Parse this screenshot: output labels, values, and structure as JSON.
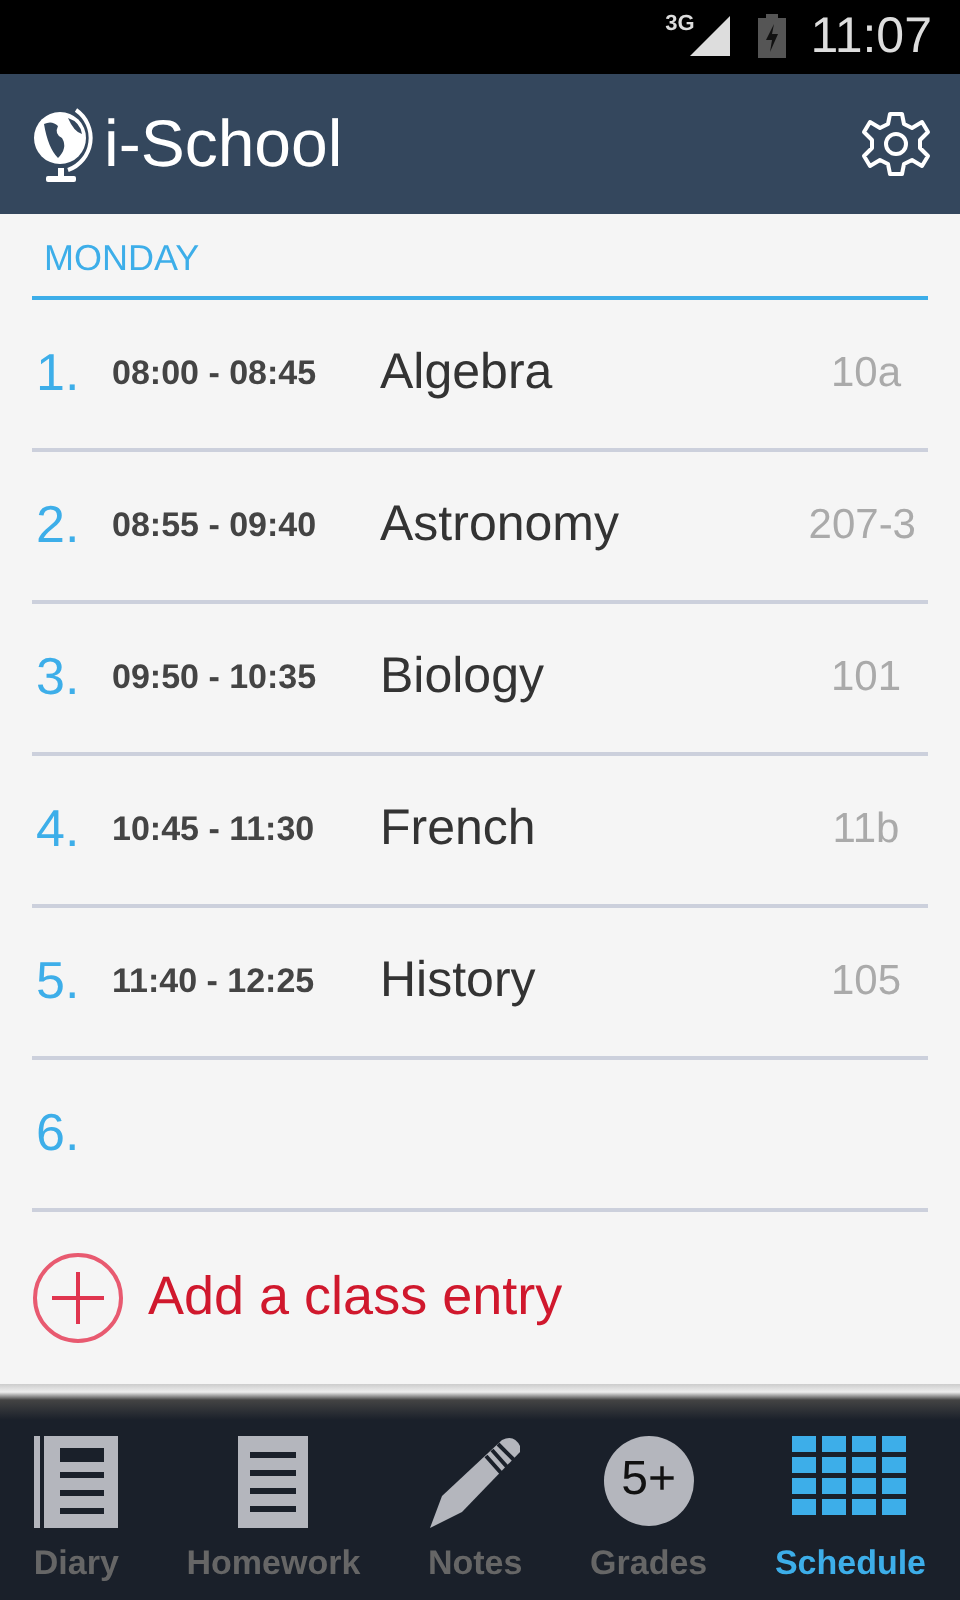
{
  "status_bar": {
    "network": "3G",
    "time": "11:07"
  },
  "app_bar": {
    "title": "i-School"
  },
  "day": {
    "title": "MONDAY"
  },
  "lessons": [
    {
      "number": "1.",
      "time": "08:00 - 08:45",
      "subject": "Algebra",
      "room": "10a"
    },
    {
      "number": "2.",
      "time": "08:55 - 09:40",
      "subject": "Astronomy",
      "room": "207-3"
    },
    {
      "number": "3.",
      "time": "09:50 - 10:35",
      "subject": "Biology",
      "room": "101"
    },
    {
      "number": "4.",
      "time": "10:45 - 11:30",
      "subject": "French",
      "room": "11b"
    },
    {
      "number": "5.",
      "time": "11:40 - 12:25",
      "subject": "History",
      "room": "105"
    },
    {
      "number": "6."
    }
  ],
  "add_entry": {
    "label": "Add a class entry"
  },
  "nav": [
    {
      "kind": "diary",
      "label": "Diary",
      "selected": false
    },
    {
      "kind": "homework",
      "label": "Homework",
      "selected": false
    },
    {
      "kind": "notes",
      "label": "Notes",
      "selected": false
    },
    {
      "kind": "grades",
      "label": "Grades",
      "badge": "5+",
      "selected": false
    },
    {
      "kind": "schedule",
      "label": "Schedule",
      "selected": true
    }
  ]
}
